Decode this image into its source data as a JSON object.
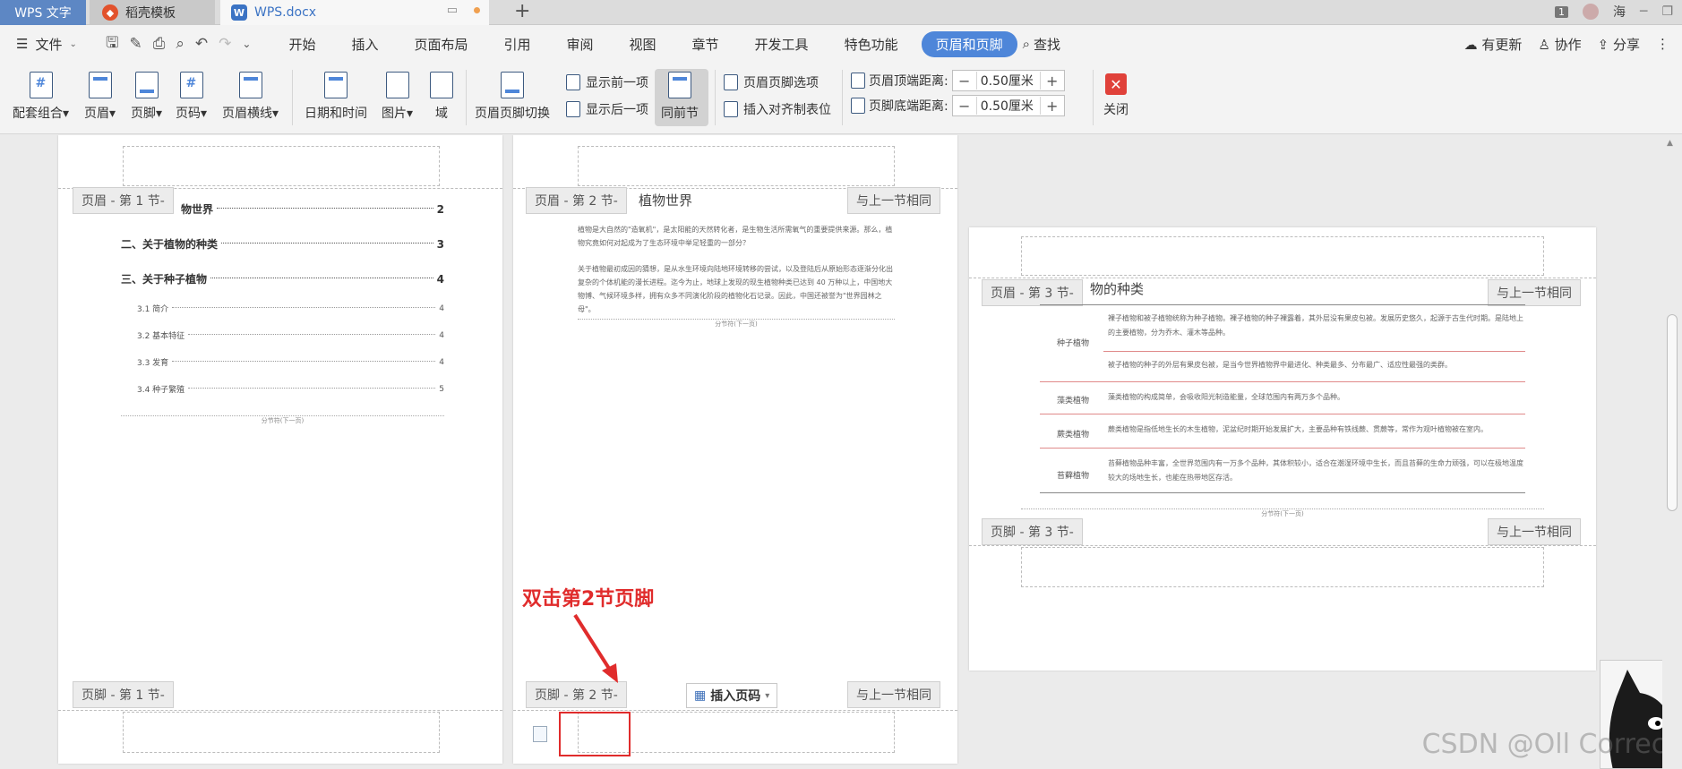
{
  "tabs": {
    "wps": "WPS 文字",
    "template": "稻壳模板",
    "document": "WPS.docx",
    "add": "+",
    "window_count": "1",
    "user": "海"
  },
  "menu": {
    "file": "文件",
    "items": [
      "开始",
      "插入",
      "页面布局",
      "引用",
      "审阅",
      "视图",
      "章节",
      "开发工具",
      "特色功能"
    ],
    "active": "页眉和页脚",
    "search": "查找",
    "update": "有更新",
    "collab": "协作",
    "share": "分享"
  },
  "ribbon": {
    "combo": "配套组合",
    "header": "页眉",
    "footer": "页脚",
    "page_num": "页码",
    "header_line": "页眉横线",
    "datetime": "日期和时间",
    "picture": "图片",
    "field": "域",
    "switch": "页眉页脚切换",
    "show_prev": "显示前一项",
    "show_next": "显示后一项",
    "same_as_prev": "同前节",
    "options": "页眉页脚选项",
    "align_tab": "插入对齐制表位",
    "header_top_label": "页眉顶端距离:",
    "header_top_value": "0.50厘米",
    "footer_bottom_label": "页脚底端距离:",
    "footer_bottom_value": "0.50厘米",
    "close": "关闭"
  },
  "page1": {
    "header_tag": "页眉 - 第 1 节-",
    "footer_tag": "页脚 - 第 1 节-",
    "toc": [
      {
        "text": "物世界",
        "page": "2"
      },
      {
        "text": "二、关于植物的种类",
        "page": "3"
      },
      {
        "text": "三、关于种子植物",
        "page": "4"
      }
    ],
    "toc_sub": [
      {
        "text": "3.1 简介",
        "page": "4"
      },
      {
        "text": "3.2 基本特征",
        "page": "4"
      },
      {
        "text": "3.3 发育",
        "page": "4"
      },
      {
        "text": "3.4 种子繁殖",
        "page": "5"
      }
    ],
    "section_break": "分节符(下一页)"
  },
  "page2": {
    "header_tag": "页眉 - 第 2 节-",
    "same_tag": "与上一节相同",
    "title": "植物世界",
    "para1": "植物是大自然的\"造氧机\"，是太阳能的天然转化者，是生物生活所需氧气的重要提供来源。那么，植物究竟如何对起成为了生态环境中举足轻重的一部分？",
    "para2": "关于植物最初成因的猜想，是从水生环境向陆地环境转移的尝试，以及登陆后从原始形态逐渐分化出复杂的个体机能的漫长进程。迄今为止，地球上发现的现生植物种类已达到 40 万种以上，中国地大物博、气候环境多样，拥有众多不同演化阶段的植物化石记录。因此，中国还被誉为\"世界园林之母\"。",
    "section_break": "分节符(下一页)",
    "footer_tag": "页脚 - 第 2 节-",
    "footer_same_tag": "与上一节相同",
    "insert_page_num": "插入页码"
  },
  "page3": {
    "header_tag": "页眉 - 第 3 节-",
    "same_tag": "与上一节相同",
    "title": "物的种类",
    "rows": [
      {
        "label": "种子植物",
        "text": "裸子植物和被子植物统称为种子植物。裸子植物的种子裸露着，其外层没有果皮包被。发展历史悠久，起源于古生代时期。是陆地上的主要植物，分为乔木、灌木等品种。"
      },
      {
        "label": "",
        "text": "被子植物的种子的外层有果皮包被，是当今世界植物界中最进化、种类最多、分布最广、适应性最强的类群。"
      },
      {
        "label": "藻类植物",
        "text": "藻类植物的构成简单，会吸收阳光制造能量，全球范围内有两万多个品种。"
      },
      {
        "label": "蕨类植物",
        "text": "蕨类植物是指低地生长的木生植物，泥盆纪时期开始发展扩大，主要品种有铁线蕨、贯蕨等，常作为观叶植物被在室内。"
      },
      {
        "label": "苔藓植物",
        "text": "苔藓植物品种丰富，全世界范围内有一万多个品种，其体积较小，适合在潮湿环境中生长，而且苔藓的生命力顽强，可以在极地温度较大的场地生长，也能在热带地区存活。"
      }
    ],
    "section_break": "分节符(下一页)",
    "footer_tag": "页脚 - 第 3 节-",
    "footer_same_tag": "与上一节相同"
  },
  "annotation": {
    "text": "双击第2节页脚",
    "color": "#e02c2c"
  },
  "watermark": "CSDN @Oll Correct",
  "colors": {
    "accent": "#4e86d9",
    "wps_tab": "#5d87c4",
    "close": "#e0413a"
  }
}
